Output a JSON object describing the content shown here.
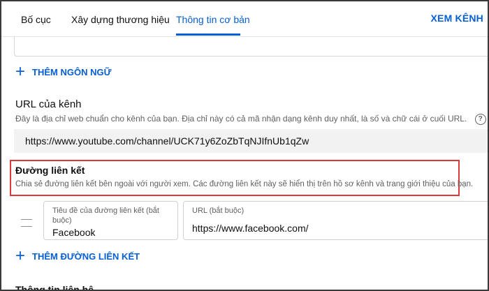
{
  "tabs": [
    {
      "label": "Bố cục"
    },
    {
      "label": "Xây dựng thương hiệu"
    },
    {
      "label": "Thông tin cơ bản"
    }
  ],
  "header": {
    "view_channel_label": "XEM KÊNH"
  },
  "add_language": {
    "label": "THÊM NGÔN NGỮ"
  },
  "channel_url": {
    "title": "URL của kênh",
    "description": "Đây là địa chỉ web chuẩn cho kênh của bạn. Địa chỉ này có cả mã nhận dạng kênh duy nhất, là số và chữ cái ở cuối URL.",
    "help_glyph": "?",
    "value": "https://www.youtube.com/channel/UCK71y6ZoZbTqNJIfnUb1qZw"
  },
  "links": {
    "title": "Đường liên kết",
    "description": "Chia sẻ đường liên kết bên ngoài với người xem. Các đường liên kết này sẽ hiển thị trên hồ sơ kênh và trang giới thiệu của bạn.",
    "items": [
      {
        "title_label": "Tiêu đề của đường liên kết (bắt buộc)",
        "title_value": "Facebook",
        "url_label": "URL (bắt buộc)",
        "url_value": "https://www.facebook.com/"
      }
    ],
    "add_label": "THÊM ĐƯỜNG LIÊN KẾT"
  },
  "contact": {
    "title": "Thông tin liên hệ"
  },
  "colors": {
    "accent": "#065fd4",
    "highlight": "#d93b3b",
    "field_bg": "#f2f2f2"
  }
}
